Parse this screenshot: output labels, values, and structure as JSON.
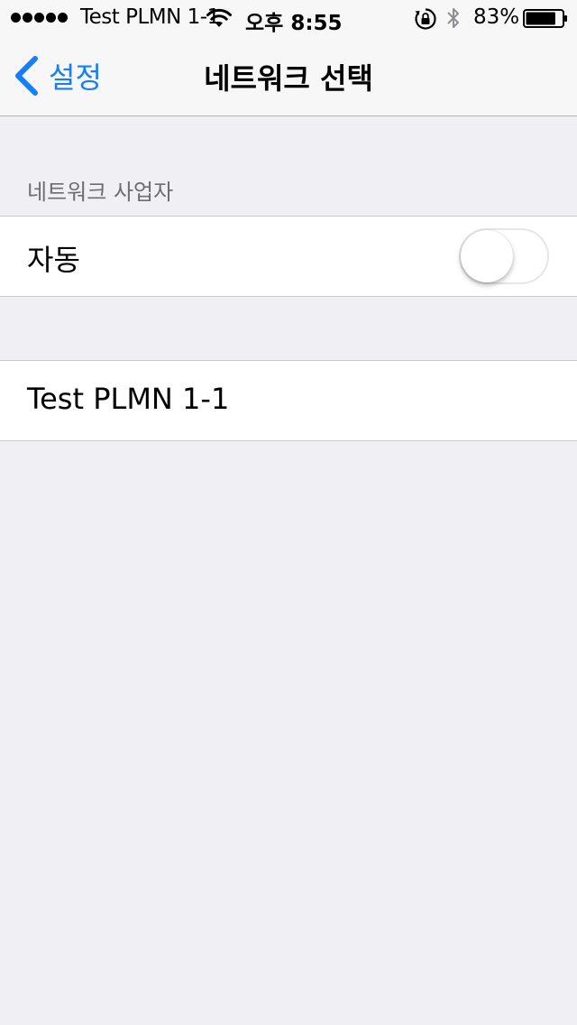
{
  "status_bar": {
    "carrier": "Test PLMN 1-1",
    "time": "오후 8:55",
    "battery_percent": "83%",
    "battery_level": 0.83,
    "signal_bars": 5,
    "icons": [
      "signal-dots-icon",
      "wifi-icon",
      "rotation-lock-icon",
      "bluetooth-icon",
      "battery-icon"
    ]
  },
  "nav": {
    "back_label": "설정",
    "title": "네트워크 선택"
  },
  "section": {
    "header": "네트워크 사업자"
  },
  "auto_row": {
    "label": "자동",
    "toggle_on": false
  },
  "networks": [
    {
      "name": "Test PLMN 1-1"
    }
  ],
  "colors": {
    "accent": "#147efb",
    "background": "#efeff4",
    "bar_background": "#f7f7f8",
    "section_header": "#6d6d72"
  }
}
